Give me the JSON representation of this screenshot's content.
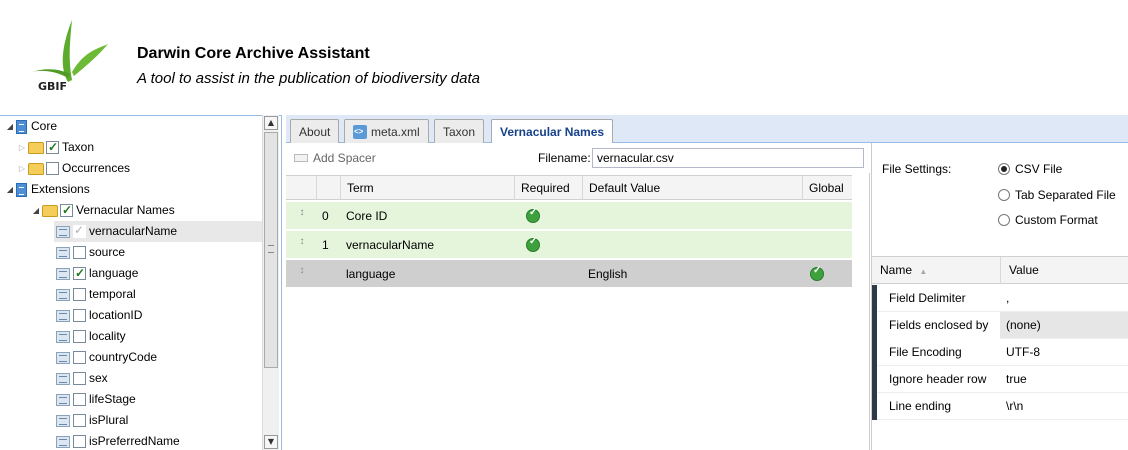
{
  "header": {
    "logo_text": "GBIF",
    "title": "Darwin Core Archive Assistant",
    "subtitle": "A tool to assist in the publication of biodiversity data"
  },
  "tree": {
    "items": [
      {
        "label": "Core",
        "icon": "doc-icon"
      },
      {
        "label": "Taxon",
        "icon": "folder-icon",
        "checked": true
      },
      {
        "label": "Occurrences",
        "icon": "folder-icon",
        "checked": false
      },
      {
        "label": "Extensions",
        "icon": "doc-icon"
      },
      {
        "label": "Vernacular Names",
        "icon": "folder-icon",
        "checked": true
      },
      {
        "label": "vernacularName",
        "icon": "field-icon",
        "checked": true,
        "selected": true
      },
      {
        "label": "source",
        "icon": "field-icon",
        "checked": false
      },
      {
        "label": "language",
        "icon": "field-icon",
        "checked": true
      },
      {
        "label": "temporal",
        "icon": "field-icon",
        "checked": false
      },
      {
        "label": "locationID",
        "icon": "field-icon",
        "checked": false
      },
      {
        "label": "locality",
        "icon": "field-icon",
        "checked": false
      },
      {
        "label": "countryCode",
        "icon": "field-icon",
        "checked": false
      },
      {
        "label": "sex",
        "icon": "field-icon",
        "checked": false
      },
      {
        "label": "lifeStage",
        "icon": "field-icon",
        "checked": false
      },
      {
        "label": "isPlural",
        "icon": "field-icon",
        "checked": false
      },
      {
        "label": "isPreferredName",
        "icon": "field-icon",
        "checked": false
      }
    ]
  },
  "tabs": [
    {
      "label": "About"
    },
    {
      "label": "meta.xml"
    },
    {
      "label": "Taxon"
    },
    {
      "label": "Vernacular Names",
      "active": true
    }
  ],
  "toolbar": {
    "add_spacer": "Add Spacer",
    "filename_label": "Filename:",
    "filename_value": "vernacular.csv"
  },
  "grid": {
    "columns": [
      "Term",
      "Required",
      "Default Value",
      "Global"
    ],
    "rows": [
      {
        "index": "0",
        "term": "Core ID",
        "required": true,
        "default": "",
        "global": false
      },
      {
        "index": "1",
        "term": "vernacularName",
        "required": true,
        "default": "",
        "global": false
      },
      {
        "index": "",
        "term": "language",
        "required": false,
        "default": "English",
        "global": true
      }
    ]
  },
  "file_settings": {
    "label": "File Settings:",
    "options": [
      {
        "label": "CSV File",
        "selected": true
      },
      {
        "label": "Tab Separated File",
        "selected": false
      },
      {
        "label": "Custom Format",
        "selected": false
      }
    ]
  },
  "properties": {
    "columns": [
      "Name",
      "Value"
    ],
    "sort_indicator": "▲",
    "rows": [
      {
        "name": "Field Delimiter",
        "value": ","
      },
      {
        "name": "Fields enclosed by",
        "value": "(none)"
      },
      {
        "name": "File Encoding",
        "value": "UTF-8"
      },
      {
        "name": "Ignore header row",
        "value": "true"
      },
      {
        "name": "Line ending",
        "value": "\\r\\n"
      }
    ]
  },
  "colors": {
    "row_green": "#e5f5dc",
    "row_gray": "#cfcfcf",
    "tab_active_text": "#15428b",
    "check_green": "#3da23d"
  }
}
